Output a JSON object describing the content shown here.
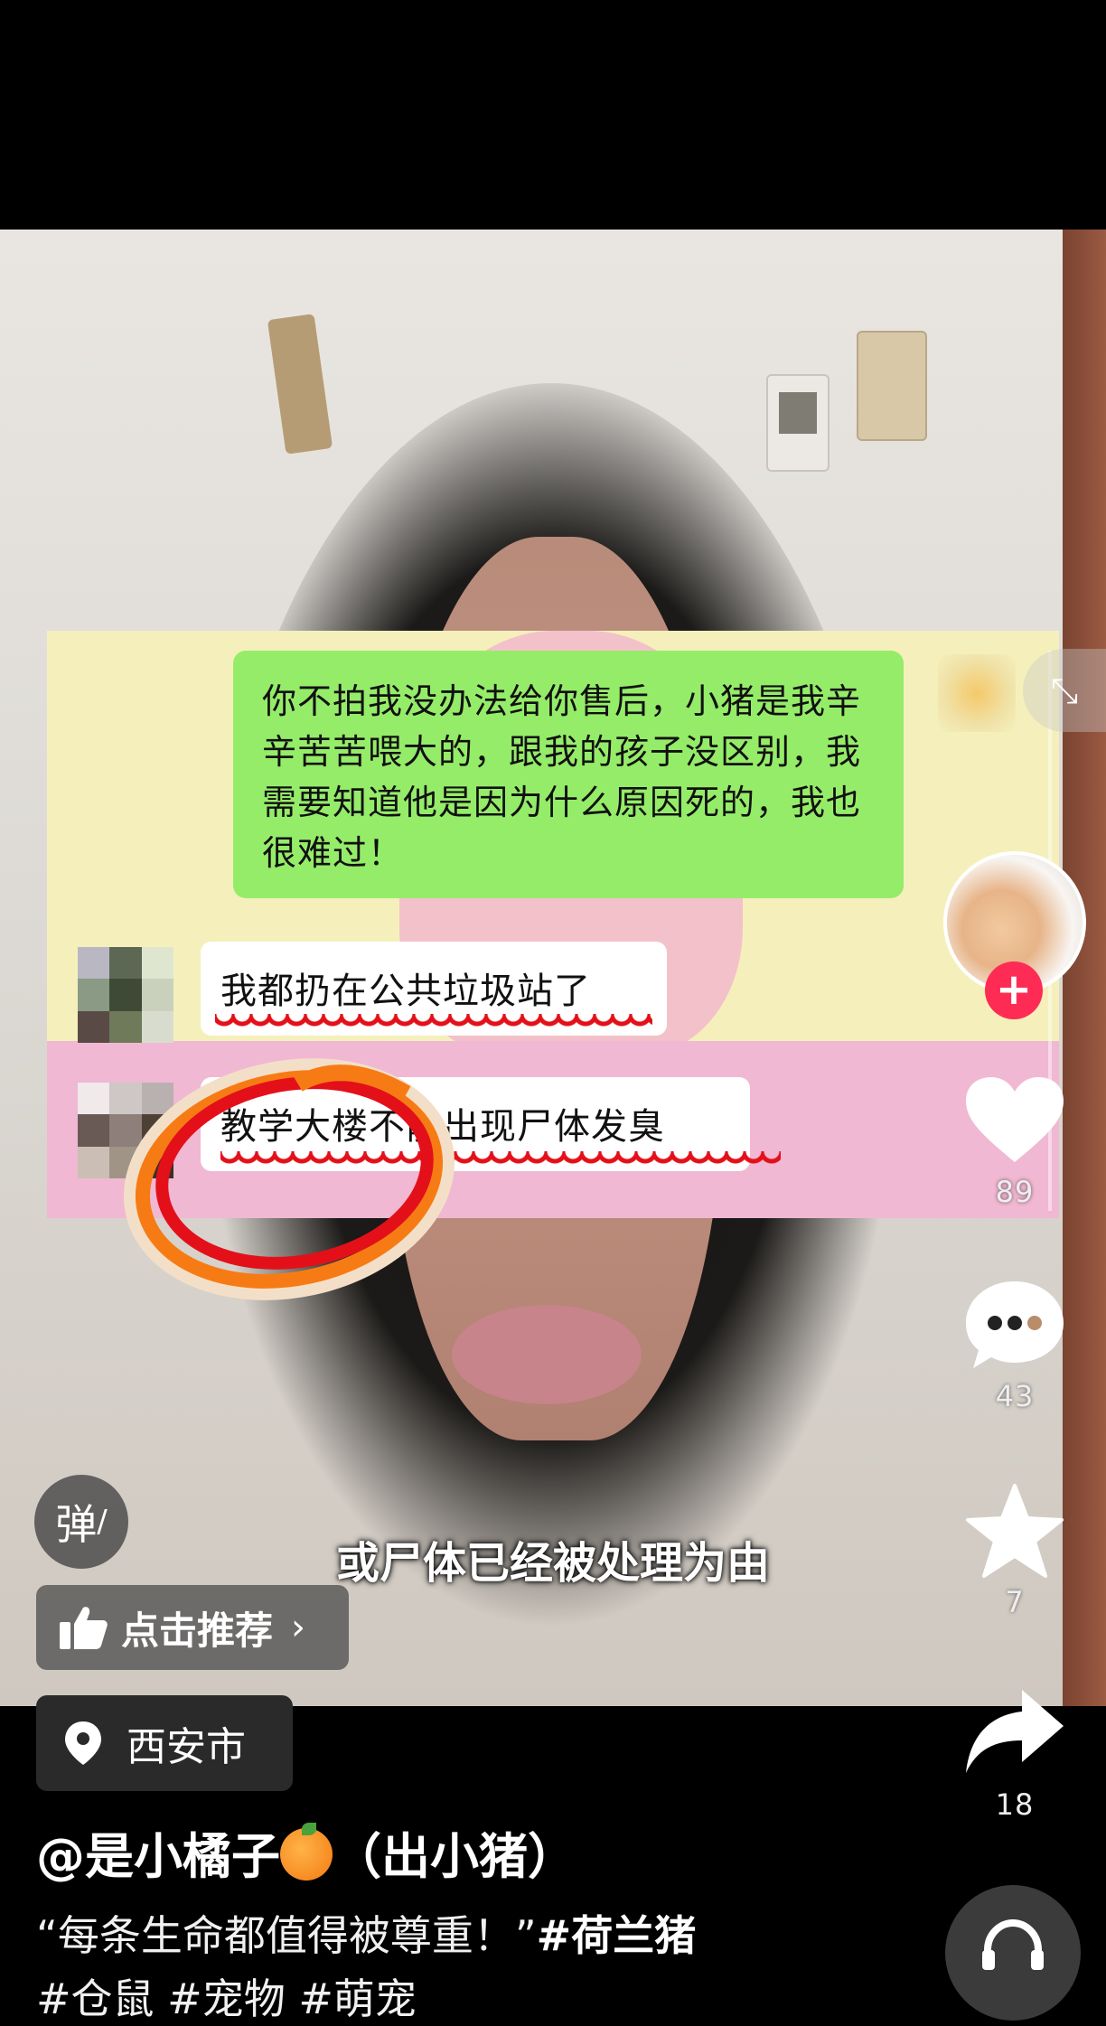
{
  "chat": {
    "my_message": "你不拍我没办法给你售后，小猪是我辛辛苦苦喂大的，跟我的孩子没区别，我需要知道他是因为什么原因死的，我也很难过！",
    "reply_1": "我都扔在公共垃圾站了",
    "reply_2": "教学大楼不能出现尸体发臭"
  },
  "subtitle": "或尸体已经被处理为由",
  "actions": {
    "likes": "89",
    "comments": "43",
    "favorites": "7",
    "shares": "18"
  },
  "danmu_label": "弹",
  "recommend_label": "点击推荐",
  "location": "西安市",
  "author": {
    "handle_prefix": "@是小橘子",
    "handle_suffix": "（出小猪）"
  },
  "description": {
    "quote": "“每条生命都值得被尊重！”",
    "hashtag": "#荷兰猪",
    "line2": "#仓鼠 #宠物 #萌宠"
  },
  "colors": {
    "accent": "#fe2c55",
    "chat_green": "#95ec69",
    "chat_bg": "#f5f0bb",
    "annotation_red": "#e3101a",
    "annotation_orange": "#f77b14"
  },
  "icons": {
    "like": "heart-icon",
    "comment": "comment-bubble-icon",
    "favorite": "star-icon",
    "share": "share-arrow-icon",
    "location": "location-pin-icon",
    "recommend": "thumbs-up-icon",
    "music": "headphones-icon"
  }
}
